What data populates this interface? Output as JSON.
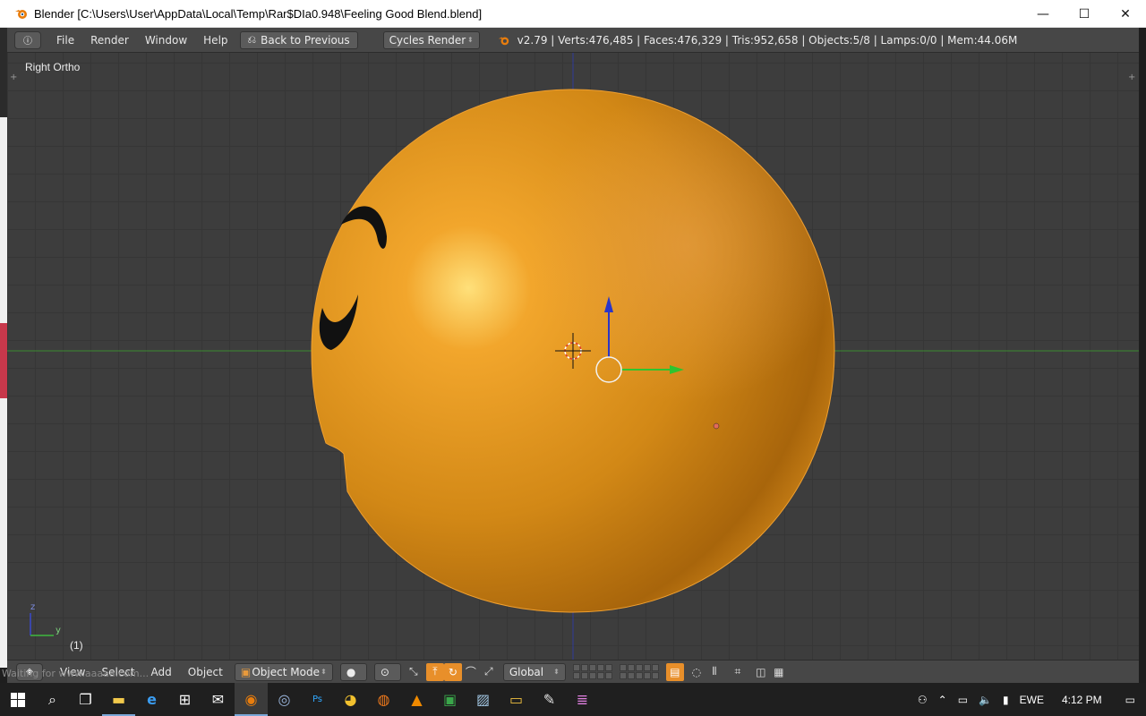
{
  "window": {
    "title": "Blender [C:\\Users\\User\\AppData\\Local\\Temp\\Rar$DIa0.948\\Feeling Good Blend.blend]",
    "minimize": "—",
    "maximize": "☐",
    "close": "✕"
  },
  "info_header": {
    "editor_icon": "info-icon",
    "menus": [
      "File",
      "Render",
      "Window",
      "Help"
    ],
    "back_button": "Back to Previous",
    "render_engine": "Cycles Render",
    "stats": "v2.79 | Verts:476,485 | Faces:476,329 | Tris:952,658 | Objects:5/8 | Lamps:0/0 | Mem:44.06M"
  },
  "viewport": {
    "view_name": "Right Ortho",
    "frame": "(1)",
    "axis_z": "z",
    "axis_y": "y"
  },
  "view_header": {
    "menus": [
      "View",
      "Select",
      "Add",
      "Object"
    ],
    "mode": "Object Mode",
    "orientation": "Global"
  },
  "status_text": "Waiting for www.aaaaa.com...",
  "taskbar": {
    "apps": [
      "windows-start-icon",
      "search-icon",
      "task-view-icon",
      "file-explorer-icon",
      "edge-icon",
      "store-icon",
      "mail-icon",
      "blender-icon",
      "steam-icon",
      "photoshop-icon",
      "chrome-icon",
      "firefox-icon",
      "vlc-icon",
      "excel-icon",
      "photos-icon",
      "notepad-icon",
      "paint-icon",
      "library-icon"
    ],
    "language": "EWE",
    "time": "4:12 PM"
  },
  "colors": {
    "object_orange": "#e08e1b",
    "viewport_bg": "#3d3d3d",
    "header_bg": "#474747",
    "accent": "#e88f2a"
  }
}
